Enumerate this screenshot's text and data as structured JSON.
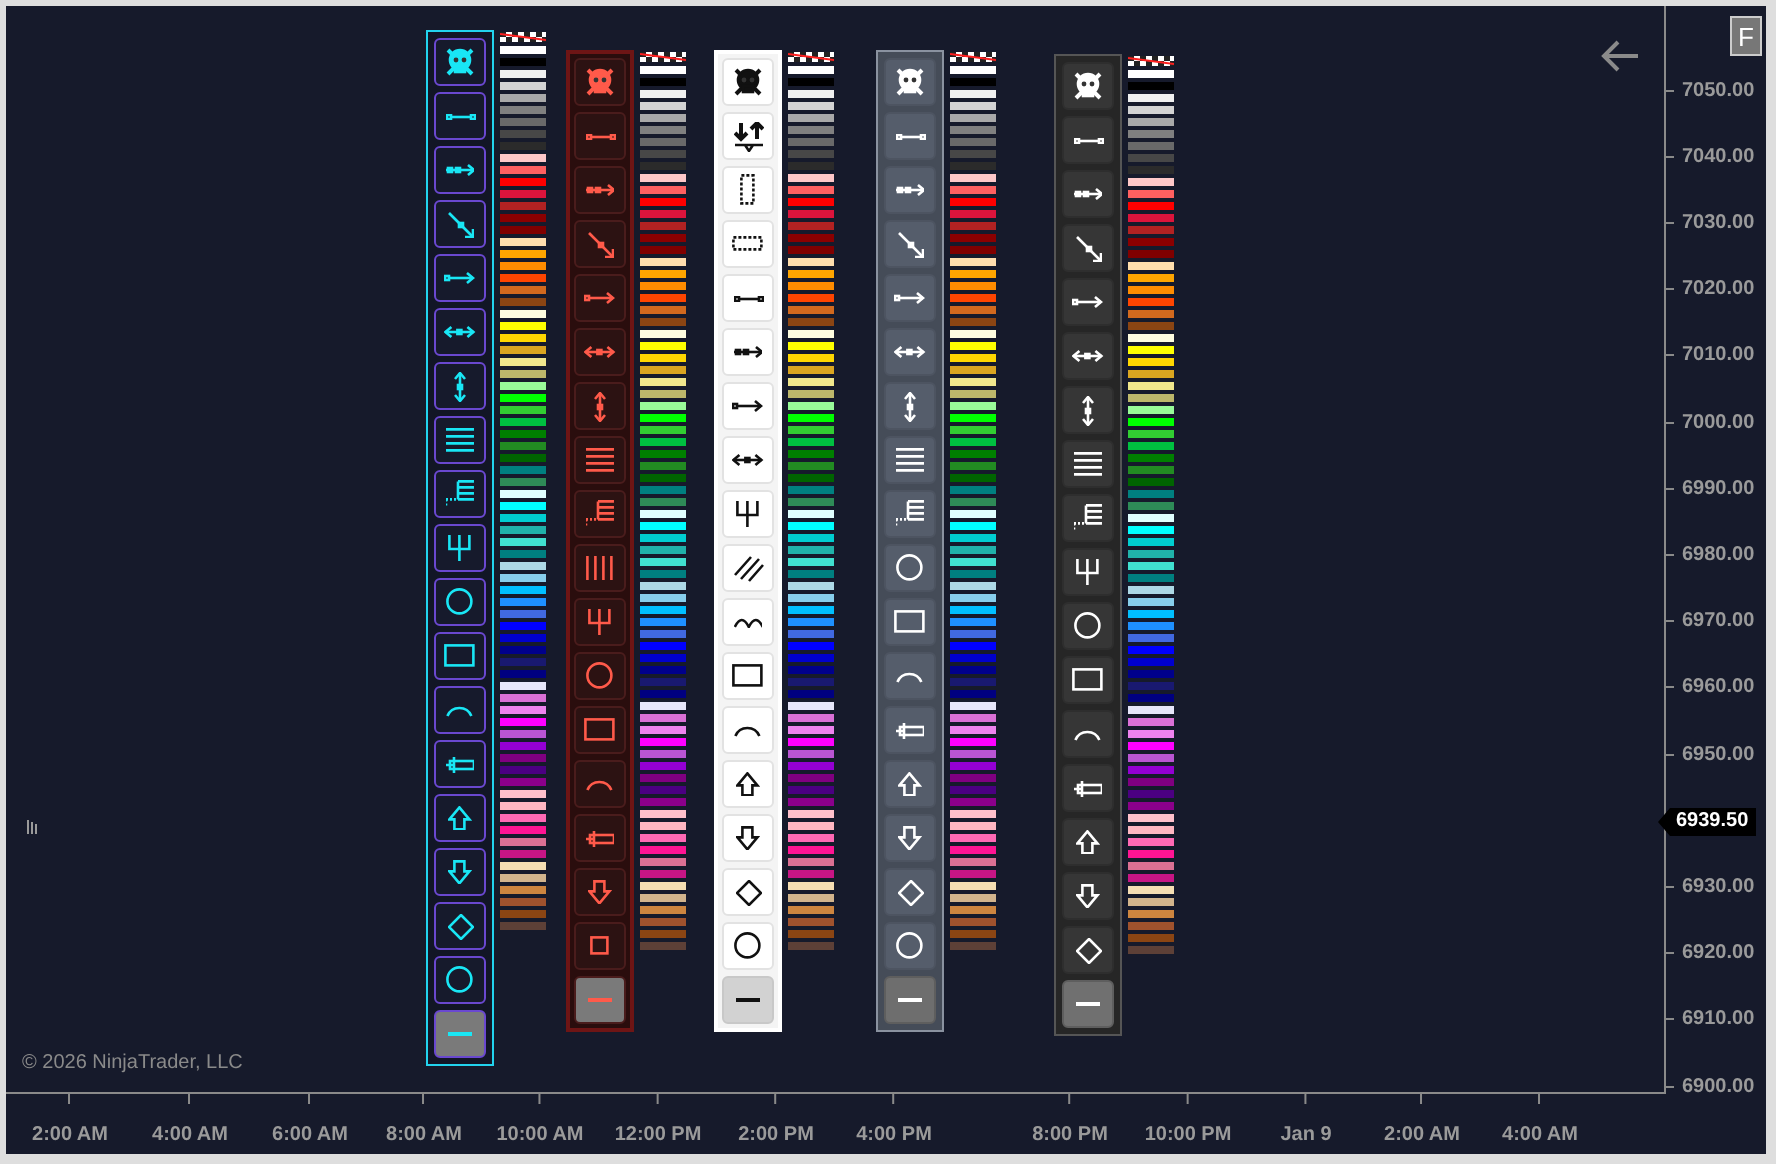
{
  "toolbars": [
    {
      "kind": "cyan",
      "clear_swatch": true,
      "tools": [
        {
          "kind": "skull",
          "selected": false
        },
        {
          "kind": "line",
          "selected": false
        },
        {
          "kind": "ray",
          "selected": false
        },
        {
          "kind": "diagonal",
          "selected": false
        },
        {
          "kind": "arrow",
          "selected": false
        },
        {
          "kind": "extended",
          "selected": false
        },
        {
          "kind": "vertical",
          "selected": false
        },
        {
          "kind": "hlines",
          "selected": false
        },
        {
          "kind": "fib",
          "selected": false
        },
        {
          "kind": "pitchfork",
          "selected": false
        },
        {
          "kind": "circle",
          "selected": false
        },
        {
          "kind": "rect",
          "selected": false
        },
        {
          "kind": "arc",
          "selected": false
        },
        {
          "kind": "ruler",
          "selected": false
        },
        {
          "kind": "up",
          "selected": false
        },
        {
          "kind": "down",
          "selected": false
        },
        {
          "kind": "diamond",
          "selected": false
        },
        {
          "kind": "circle",
          "selected": false
        },
        {
          "kind": "hline",
          "selected": true
        }
      ],
      "swatches": [
        {
          "color": "#ffffff"
        },
        {
          "color": "#000000"
        },
        {
          "color": "#f0f0f0"
        },
        {
          "color": "#d3d3d3"
        },
        {
          "color": "#a9a9a9"
        },
        {
          "color": "#808080"
        },
        {
          "color": "#696969"
        },
        {
          "color": "#474747"
        },
        {
          "color": "#2b2b2b"
        },
        {
          "color": "#ffc8c8"
        },
        {
          "color": "#ff6060"
        },
        {
          "color": "#ff0000"
        },
        {
          "color": "#dc143c"
        },
        {
          "color": "#b22222"
        },
        {
          "color": "#8b0000"
        },
        {
          "color": "#800000"
        },
        {
          "color": "#ffdead"
        },
        {
          "color": "#ffa500"
        },
        {
          "color": "#ff8c00"
        },
        {
          "color": "#ff4500"
        },
        {
          "color": "#d2691e"
        },
        {
          "color": "#8b4513"
        },
        {
          "color": "#fffde0"
        },
        {
          "color": "#ffff00"
        },
        {
          "color": "#ffd700"
        },
        {
          "color": "#daa520"
        },
        {
          "color": "#f0e68c"
        },
        {
          "color": "#bdb76b"
        },
        {
          "color": "#98fb98"
        },
        {
          "color": "#00ff00"
        },
        {
          "color": "#32cd32"
        },
        {
          "color": "#00c040"
        },
        {
          "color": "#008000"
        },
        {
          "color": "#228b22"
        },
        {
          "color": "#006400"
        },
        {
          "color": "#008080"
        },
        {
          "color": "#2e8b57"
        },
        {
          "color": "#e0ffff"
        },
        {
          "color": "#00ffff"
        },
        {
          "color": "#00ced1"
        },
        {
          "color": "#20b2aa"
        },
        {
          "color": "#40e0d0"
        },
        {
          "color": "#008080"
        },
        {
          "color": "#add8e6"
        },
        {
          "color": "#87ceeb"
        },
        {
          "color": "#00bfff"
        },
        {
          "color": "#1e90ff"
        },
        {
          "color": "#4169e1"
        },
        {
          "color": "#0000ff"
        },
        {
          "color": "#0000cd"
        },
        {
          "color": "#00008b"
        },
        {
          "color": "#191970"
        },
        {
          "color": "#000080"
        },
        {
          "color": "#e6e6fa"
        },
        {
          "color": "#da70d6"
        },
        {
          "color": "#ee82ee"
        },
        {
          "color": "#ff00ff"
        },
        {
          "color": "#ba55d3"
        },
        {
          "color": "#9400d3"
        },
        {
          "color": "#800080"
        },
        {
          "color": "#4b0082"
        },
        {
          "color": "#8b008b"
        },
        {
          "color": "#ffc0cb"
        },
        {
          "color": "#ffb6c1"
        },
        {
          "color": "#ff69b4"
        },
        {
          "color": "#ff1493"
        },
        {
          "color": "#db7093"
        },
        {
          "color": "#c71585"
        },
        {
          "color": "#f5deb3"
        },
        {
          "color": "#d2b48c"
        },
        {
          "color": "#cd853f"
        },
        {
          "color": "#a0522d"
        },
        {
          "color": "#8b4513"
        },
        {
          "color": "#5d4037"
        }
      ]
    },
    {
      "kind": "red",
      "clear_swatch": true,
      "tools": [
        {
          "kind": "skull",
          "selected": false
        },
        {
          "kind": "line",
          "selected": false
        },
        {
          "kind": "ray",
          "selected": false
        },
        {
          "kind": "diagonal",
          "selected": false
        },
        {
          "kind": "arrow",
          "selected": false
        },
        {
          "kind": "extended",
          "selected": false
        },
        {
          "kind": "vertical",
          "selected": false
        },
        {
          "kind": "hlines",
          "selected": false
        },
        {
          "kind": "fib",
          "selected": false
        },
        {
          "kind": "vbars",
          "selected": false
        },
        {
          "kind": "pitchfork",
          "selected": false
        },
        {
          "kind": "circle",
          "selected": false
        },
        {
          "kind": "rect",
          "selected": false
        },
        {
          "kind": "arc",
          "selected": false
        },
        {
          "kind": "ruler",
          "selected": false
        },
        {
          "kind": "down",
          "selected": false
        },
        {
          "kind": "square",
          "selected": false
        },
        {
          "kind": "hline",
          "selected": true
        }
      ],
      "swatches": [
        {
          "color": "#ffffff"
        },
        {
          "color": "#000000"
        },
        {
          "color": "#f0f0f0"
        },
        {
          "color": "#d3d3d3"
        },
        {
          "color": "#a9a9a9"
        },
        {
          "color": "#808080"
        },
        {
          "color": "#696969"
        },
        {
          "color": "#474747"
        },
        {
          "color": "#2b2b2b"
        },
        {
          "color": "#ffc8c8"
        },
        {
          "color": "#ff6060"
        },
        {
          "color": "#ff0000"
        },
        {
          "color": "#dc143c"
        },
        {
          "color": "#b22222"
        },
        {
          "color": "#8b0000"
        },
        {
          "color": "#800000"
        },
        {
          "color": "#ffdead"
        },
        {
          "color": "#ffa500"
        },
        {
          "color": "#ff8c00"
        },
        {
          "color": "#ff4500"
        },
        {
          "color": "#d2691e"
        },
        {
          "color": "#8b4513"
        },
        {
          "color": "#fffde0"
        },
        {
          "color": "#ffff00"
        },
        {
          "color": "#ffd700"
        },
        {
          "color": "#daa520"
        },
        {
          "color": "#f0e68c"
        },
        {
          "color": "#bdb76b"
        },
        {
          "color": "#98fb98"
        },
        {
          "color": "#00ff00"
        },
        {
          "color": "#32cd32"
        },
        {
          "color": "#00c040"
        },
        {
          "color": "#008000"
        },
        {
          "color": "#228b22"
        },
        {
          "color": "#006400"
        },
        {
          "color": "#008080"
        },
        {
          "color": "#2e8b57"
        },
        {
          "color": "#e0ffff"
        },
        {
          "color": "#00ffff"
        },
        {
          "color": "#00ced1"
        },
        {
          "color": "#20b2aa"
        },
        {
          "color": "#40e0d0"
        },
        {
          "color": "#008080"
        },
        {
          "color": "#add8e6"
        },
        {
          "color": "#87ceeb"
        },
        {
          "color": "#00bfff"
        },
        {
          "color": "#1e90ff"
        },
        {
          "color": "#4169e1"
        },
        {
          "color": "#0000ff"
        },
        {
          "color": "#0000cd"
        },
        {
          "color": "#00008b"
        },
        {
          "color": "#191970"
        },
        {
          "color": "#000080"
        },
        {
          "color": "#e6e6fa"
        },
        {
          "color": "#da70d6"
        },
        {
          "color": "#ee82ee"
        },
        {
          "color": "#ff00ff"
        },
        {
          "color": "#ba55d3"
        },
        {
          "color": "#9400d3"
        },
        {
          "color": "#800080"
        },
        {
          "color": "#4b0082"
        },
        {
          "color": "#8b008b"
        },
        {
          "color": "#ffc0cb"
        },
        {
          "color": "#ffb6c1"
        },
        {
          "color": "#ff69b4"
        },
        {
          "color": "#ff1493"
        },
        {
          "color": "#db7093"
        },
        {
          "color": "#c71585"
        },
        {
          "color": "#f5deb3"
        },
        {
          "color": "#d2b48c"
        },
        {
          "color": "#cd853f"
        },
        {
          "color": "#a0522d"
        },
        {
          "color": "#8b4513"
        },
        {
          "color": "#5d4037"
        }
      ]
    },
    {
      "kind": "light",
      "clear_swatch": true,
      "tools": [
        {
          "kind": "skull",
          "selected": false
        },
        {
          "kind": "flip",
          "selected": false
        },
        {
          "kind": "vzone",
          "selected": false
        },
        {
          "kind": "hzone",
          "selected": false
        },
        {
          "kind": "line",
          "selected": false
        },
        {
          "kind": "ray",
          "selected": false
        },
        {
          "kind": "arrow",
          "selected": false
        },
        {
          "kind": "extended",
          "selected": false
        },
        {
          "kind": "pitchfork",
          "selected": false
        },
        {
          "kind": "channel",
          "selected": false
        },
        {
          "kind": "curves",
          "selected": false
        },
        {
          "kind": "rect",
          "selected": false
        },
        {
          "kind": "arc",
          "selected": false
        },
        {
          "kind": "up",
          "selected": false
        },
        {
          "kind": "down",
          "selected": false
        },
        {
          "kind": "diamond",
          "selected": false
        },
        {
          "kind": "circle",
          "selected": false
        },
        {
          "kind": "hline",
          "selected": true
        }
      ],
      "swatches": [
        {
          "color": "#ffffff"
        },
        {
          "color": "#000000"
        },
        {
          "color": "#f0f0f0"
        },
        {
          "color": "#d3d3d3"
        },
        {
          "color": "#a9a9a9"
        },
        {
          "color": "#808080"
        },
        {
          "color": "#696969"
        },
        {
          "color": "#474747"
        },
        {
          "color": "#2b2b2b"
        },
        {
          "color": "#ffc8c8"
        },
        {
          "color": "#ff6060"
        },
        {
          "color": "#ff0000"
        },
        {
          "color": "#dc143c"
        },
        {
          "color": "#b22222"
        },
        {
          "color": "#8b0000"
        },
        {
          "color": "#800000"
        },
        {
          "color": "#ffdead"
        },
        {
          "color": "#ffa500"
        },
        {
          "color": "#ff8c00"
        },
        {
          "color": "#ff4500"
        },
        {
          "color": "#d2691e"
        },
        {
          "color": "#8b4513"
        },
        {
          "color": "#fffde0"
        },
        {
          "color": "#ffff00"
        },
        {
          "color": "#ffd700"
        },
        {
          "color": "#daa520"
        },
        {
          "color": "#f0e68c"
        },
        {
          "color": "#bdb76b"
        },
        {
          "color": "#98fb98"
        },
        {
          "color": "#00ff00"
        },
        {
          "color": "#32cd32"
        },
        {
          "color": "#00c040"
        },
        {
          "color": "#008000"
        },
        {
          "color": "#228b22"
        },
        {
          "color": "#006400"
        },
        {
          "color": "#008080"
        },
        {
          "color": "#2e8b57"
        },
        {
          "color": "#e0ffff"
        },
        {
          "color": "#00ffff"
        },
        {
          "color": "#00ced1"
        },
        {
          "color": "#20b2aa"
        },
        {
          "color": "#40e0d0"
        },
        {
          "color": "#008080"
        },
        {
          "color": "#add8e6"
        },
        {
          "color": "#87ceeb"
        },
        {
          "color": "#00bfff"
        },
        {
          "color": "#1e90ff"
        },
        {
          "color": "#4169e1"
        },
        {
          "color": "#0000ff"
        },
        {
          "color": "#0000cd"
        },
        {
          "color": "#00008b"
        },
        {
          "color": "#191970"
        },
        {
          "color": "#000080"
        },
        {
          "color": "#e6e6fa"
        },
        {
          "color": "#da70d6"
        },
        {
          "color": "#ee82ee"
        },
        {
          "color": "#ff00ff"
        },
        {
          "color": "#ba55d3"
        },
        {
          "color": "#9400d3"
        },
        {
          "color": "#800080"
        },
        {
          "color": "#4b0082"
        },
        {
          "color": "#8b008b"
        },
        {
          "color": "#ffc0cb"
        },
        {
          "color": "#ffb6c1"
        },
        {
          "color": "#ff69b4"
        },
        {
          "color": "#ff1493"
        },
        {
          "color": "#db7093"
        },
        {
          "color": "#c71585"
        },
        {
          "color": "#f5deb3"
        },
        {
          "color": "#d2b48c"
        },
        {
          "color": "#cd853f"
        },
        {
          "color": "#a0522d"
        },
        {
          "color": "#8b4513"
        },
        {
          "color": "#5d4037"
        }
      ]
    },
    {
      "kind": "slate",
      "clear_swatch": true,
      "tools": [
        {
          "kind": "skull",
          "selected": false
        },
        {
          "kind": "line",
          "selected": false
        },
        {
          "kind": "ray",
          "selected": false
        },
        {
          "kind": "diagonal",
          "selected": false
        },
        {
          "kind": "arrow",
          "selected": false
        },
        {
          "kind": "extended",
          "selected": false
        },
        {
          "kind": "vertical",
          "selected": false
        },
        {
          "kind": "hlines",
          "selected": false
        },
        {
          "kind": "fib",
          "selected": false
        },
        {
          "kind": "circle",
          "selected": false
        },
        {
          "kind": "rect",
          "selected": false
        },
        {
          "kind": "arc",
          "selected": false
        },
        {
          "kind": "ruler",
          "selected": false
        },
        {
          "kind": "up",
          "selected": false
        },
        {
          "kind": "down",
          "selected": false
        },
        {
          "kind": "diamond",
          "selected": false
        },
        {
          "kind": "circle",
          "selected": false
        },
        {
          "kind": "hline",
          "selected": true
        }
      ],
      "swatches": [
        {
          "color": "#ffffff"
        },
        {
          "color": "#000000"
        },
        {
          "color": "#f0f0f0"
        },
        {
          "color": "#d3d3d3"
        },
        {
          "color": "#a9a9a9"
        },
        {
          "color": "#808080"
        },
        {
          "color": "#696969"
        },
        {
          "color": "#474747"
        },
        {
          "color": "#2b2b2b"
        },
        {
          "color": "#ffc8c8"
        },
        {
          "color": "#ff6060"
        },
        {
          "color": "#ff0000"
        },
        {
          "color": "#dc143c"
        },
        {
          "color": "#b22222"
        },
        {
          "color": "#8b0000"
        },
        {
          "color": "#800000"
        },
        {
          "color": "#ffdead"
        },
        {
          "color": "#ffa500"
        },
        {
          "color": "#ff8c00"
        },
        {
          "color": "#ff4500"
        },
        {
          "color": "#d2691e"
        },
        {
          "color": "#8b4513"
        },
        {
          "color": "#fffde0"
        },
        {
          "color": "#ffff00"
        },
        {
          "color": "#ffd700"
        },
        {
          "color": "#daa520"
        },
        {
          "color": "#f0e68c"
        },
        {
          "color": "#bdb76b"
        },
        {
          "color": "#98fb98"
        },
        {
          "color": "#00ff00"
        },
        {
          "color": "#32cd32"
        },
        {
          "color": "#00c040"
        },
        {
          "color": "#008000"
        },
        {
          "color": "#228b22"
        },
        {
          "color": "#006400"
        },
        {
          "color": "#008080"
        },
        {
          "color": "#2e8b57"
        },
        {
          "color": "#e0ffff"
        },
        {
          "color": "#00ffff"
        },
        {
          "color": "#00ced1"
        },
        {
          "color": "#20b2aa"
        },
        {
          "color": "#40e0d0"
        },
        {
          "color": "#008080"
        },
        {
          "color": "#add8e6"
        },
        {
          "color": "#87ceeb"
        },
        {
          "color": "#00bfff"
        },
        {
          "color": "#1e90ff"
        },
        {
          "color": "#4169e1"
        },
        {
          "color": "#0000ff"
        },
        {
          "color": "#0000cd"
        },
        {
          "color": "#00008b"
        },
        {
          "color": "#191970"
        },
        {
          "color": "#000080"
        },
        {
          "color": "#e6e6fa"
        },
        {
          "color": "#da70d6"
        },
        {
          "color": "#ee82ee"
        },
        {
          "color": "#ff00ff"
        },
        {
          "color": "#ba55d3"
        },
        {
          "color": "#9400d3"
        },
        {
          "color": "#800080"
        },
        {
          "color": "#4b0082"
        },
        {
          "color": "#8b008b"
        },
        {
          "color": "#ffc0cb"
        },
        {
          "color": "#ffb6c1"
        },
        {
          "color": "#ff69b4"
        },
        {
          "color": "#ff1493"
        },
        {
          "color": "#db7093"
        },
        {
          "color": "#c71585"
        },
        {
          "color": "#f5deb3"
        },
        {
          "color": "#d2b48c"
        },
        {
          "color": "#cd853f"
        },
        {
          "color": "#a0522d"
        },
        {
          "color": "#8b4513"
        },
        {
          "color": "#5d4037"
        }
      ]
    },
    {
      "kind": "charcoal",
      "clear_swatch": true,
      "tools": [
        {
          "kind": "skull",
          "selected": false
        },
        {
          "kind": "line",
          "selected": false
        },
        {
          "kind": "ray",
          "selected": false
        },
        {
          "kind": "diagonal",
          "selected": false
        },
        {
          "kind": "arrow",
          "selected": false
        },
        {
          "kind": "extended",
          "selected": false
        },
        {
          "kind": "vertical",
          "selected": false
        },
        {
          "kind": "hlines",
          "selected": false
        },
        {
          "kind": "fib",
          "selected": false
        },
        {
          "kind": "pitchfork",
          "selected": false
        },
        {
          "kind": "circle",
          "selected": false
        },
        {
          "kind": "rect",
          "selected": false
        },
        {
          "kind": "arc",
          "selected": false
        },
        {
          "kind": "ruler",
          "selected": false
        },
        {
          "kind": "up",
          "selected": false
        },
        {
          "kind": "down",
          "selected": false
        },
        {
          "kind": "diamond",
          "selected": false
        },
        {
          "kind": "hline",
          "selected": true
        }
      ],
      "swatches": [
        {
          "color": "#ffffff"
        },
        {
          "color": "#000000"
        },
        {
          "color": "#f0f0f0"
        },
        {
          "color": "#d3d3d3"
        },
        {
          "color": "#a9a9a9"
        },
        {
          "color": "#808080"
        },
        {
          "color": "#696969"
        },
        {
          "color": "#474747"
        },
        {
          "color": "#2b2b2b"
        },
        {
          "color": "#ffc8c8"
        },
        {
          "color": "#ff6060"
        },
        {
          "color": "#ff0000"
        },
        {
          "color": "#dc143c"
        },
        {
          "color": "#b22222"
        },
        {
          "color": "#8b0000"
        },
        {
          "color": "#800000"
        },
        {
          "color": "#ffdead"
        },
        {
          "color": "#ffa500"
        },
        {
          "color": "#ff8c00"
        },
        {
          "color": "#ff4500"
        },
        {
          "color": "#d2691e"
        },
        {
          "color": "#8b4513"
        },
        {
          "color": "#fffde0"
        },
        {
          "color": "#ffff00"
        },
        {
          "color": "#ffd700"
        },
        {
          "color": "#daa520"
        },
        {
          "color": "#f0e68c"
        },
        {
          "color": "#bdb76b"
        },
        {
          "color": "#98fb98"
        },
        {
          "color": "#00ff00"
        },
        {
          "color": "#32cd32"
        },
        {
          "color": "#00c040"
        },
        {
          "color": "#008000"
        },
        {
          "color": "#228b22"
        },
        {
          "color": "#006400"
        },
        {
          "color": "#008080"
        },
        {
          "color": "#2e8b57"
        },
        {
          "color": "#e0ffff"
        },
        {
          "color": "#00ffff"
        },
        {
          "color": "#00ced1"
        },
        {
          "color": "#20b2aa"
        },
        {
          "color": "#40e0d0"
        },
        {
          "color": "#008080"
        },
        {
          "color": "#add8e6"
        },
        {
          "color": "#87ceeb"
        },
        {
          "color": "#00bfff"
        },
        {
          "color": "#1e90ff"
        },
        {
          "color": "#4169e1"
        },
        {
          "color": "#0000ff"
        },
        {
          "color": "#0000cd"
        },
        {
          "color": "#00008b"
        },
        {
          "color": "#191970"
        },
        {
          "color": "#000080"
        },
        {
          "color": "#e6e6fa"
        },
        {
          "color": "#da70d6"
        },
        {
          "color": "#ee82ee"
        },
        {
          "color": "#ff00ff"
        },
        {
          "color": "#ba55d3"
        },
        {
          "color": "#9400d3"
        },
        {
          "color": "#800080"
        },
        {
          "color": "#4b0082"
        },
        {
          "color": "#8b008b"
        },
        {
          "color": "#ffc0cb"
        },
        {
          "color": "#ffb6c1"
        },
        {
          "color": "#ff69b4"
        },
        {
          "color": "#ff1493"
        },
        {
          "color": "#db7093"
        },
        {
          "color": "#c71585"
        },
        {
          "color": "#f5deb3"
        },
        {
          "color": "#d2b48c"
        },
        {
          "color": "#cd853f"
        },
        {
          "color": "#a0522d"
        },
        {
          "color": "#8b4513"
        },
        {
          "color": "#5d4037"
        }
      ]
    }
  ],
  "copyright": "© 2026 NinjaTrader, LLC",
  "f_button": "F",
  "price_marker": "6939.50",
  "y_axis": {
    "labels": [
      "7050.00",
      "7040.00",
      "7030.00",
      "7020.00",
      "7010.00",
      "7000.00",
      "6990.00",
      "6980.00",
      "6970.00",
      "6960.00",
      "6950.00",
      "6930.00",
      "6920.00",
      "6910.00",
      "6900.00"
    ]
  },
  "x_axis": {
    "labels": [
      "2:00 AM",
      "4:00 AM",
      "6:00 AM",
      "8:00 AM",
      "10:00 AM",
      "12:00 PM",
      "2:00 PM",
      "4:00 PM",
      "8:00 PM",
      "10:00 PM",
      "Jan 9",
      "2:00 AM",
      "4:00 AM"
    ]
  }
}
